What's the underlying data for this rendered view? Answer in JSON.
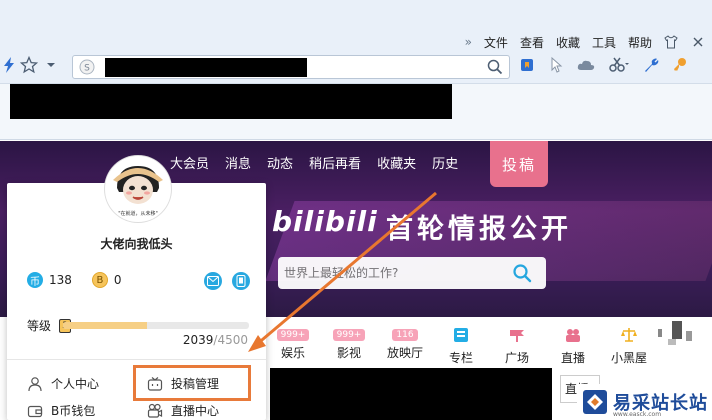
{
  "browser": {
    "menu": {
      "chevron": "»",
      "items": [
        "文件",
        "查看",
        "收藏",
        "工具",
        "帮助"
      ]
    },
    "toolbar_icons": [
      "lightning-icon",
      "star-icon",
      "dropdown-icon",
      "bookmark-icon",
      "cursor-icon",
      "cloud-icon",
      "scissors-icon",
      "wrench-icon",
      "key-icon"
    ]
  },
  "site": {
    "nav": [
      "大会员",
      "消息",
      "动态",
      "稍后再看",
      "收藏夹",
      "历史"
    ],
    "upload_label": "投稿",
    "logo_text": "bilibili",
    "promo_title": "首轮情报公开",
    "search_placeholder": "世界上最轻松的工作?",
    "categories": [
      {
        "badge": "999+",
        "label": "娱乐"
      },
      {
        "badge": "999+",
        "label": "影视"
      },
      {
        "badge": "116",
        "label": "放映厅"
      },
      {
        "badge": "",
        "label": "专栏",
        "icon_color": "#23ade5"
      },
      {
        "badge": "",
        "label": "广场",
        "icon_color": "#e8718d"
      },
      {
        "badge": "",
        "label": "直播",
        "icon_color": "#e8718d"
      },
      {
        "badge": "",
        "label": "小黑屋",
        "icon_color": "#f0b020"
      }
    ],
    "live_label": "直播"
  },
  "card": {
    "username": "大佬向我低头",
    "avatar_caption": "\"在就道，从未移\"",
    "coin_label": "币",
    "coins": "138",
    "bcoin_label": "B",
    "bcoins": "0",
    "level_label": "等级",
    "level_value": "3",
    "exp_current": "2039",
    "exp_total": "/4500",
    "exp_fraction": 0.453,
    "menu": {
      "personal_center": "个人中心",
      "manage_uploads": "投稿管理",
      "bcoin_wallet": "B币钱包",
      "live_center": "直播中心"
    }
  },
  "watermark": {
    "name": "易采站长站",
    "url": "www.easck.com"
  },
  "colors": {
    "accent_pink": "#e8718d",
    "highlight_orange": "#e87a3a",
    "banner_purple": "#3a1d57"
  }
}
